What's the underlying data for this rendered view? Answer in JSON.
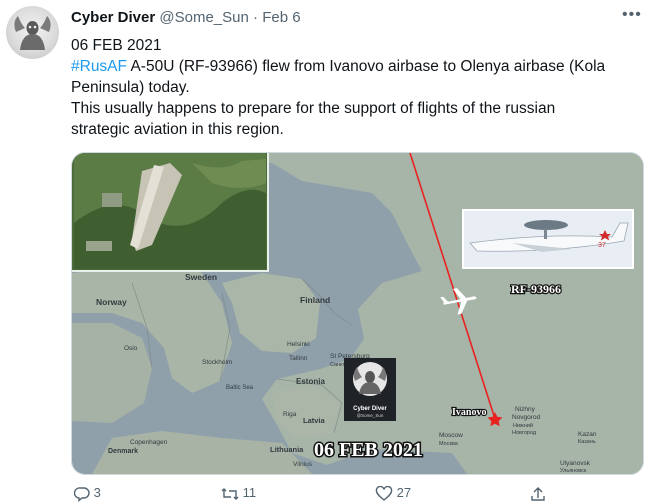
{
  "tweet": {
    "author_name": "Cyber Diver",
    "handle": "@Some_Sun",
    "separator": "·",
    "date": "Feb 6",
    "more_label": "•••",
    "date_line": "06 FEB 2021",
    "hashtag": "#RusAF",
    "line1_rest": " A-50U (RF-93966) flew from Ivanovo airbase to Olenya airbase (Kola",
    "line2": "Peninsula) today.",
    "line3": "This usually happens to prepare for the support of flights of the russian",
    "line4": "strategic aviation in this region."
  },
  "media": {
    "map_labels": {
      "sweden": "Sweden",
      "norway": "Norway",
      "finland": "Finland",
      "oslo": "Oslo",
      "stockholm": "Stockholm",
      "helsinki": "Helsinki",
      "tallinn": "Tallinn",
      "st_petersburg": "St Petersburg",
      "st_petersburg_ru": "Санкт-Петербург",
      "estonia": "Estonia",
      "baltic_sea": "Baltic Sea",
      "riga": "Riga",
      "latvia": "Latvia",
      "copenhagen": "Copenhagen",
      "denmark": "Denmark",
      "lithuania": "Lithuania",
      "vilnius": "Vilnius",
      "moscow": "Moscow",
      "moscow_ru": "Москва",
      "nizhny": "Nizhny",
      "novgorod": "Novgorod",
      "nizhny_ru": "Нижний",
      "novgorod_ru": "Новгород",
      "kazan": "Kazan",
      "kazan_ru": "Казань",
      "ulyanovsk": "Ulyanovsk",
      "ulyanovsk_ru": "Ульяновск"
    },
    "ivanovo_label": "Ivanovo",
    "aircraft_reg": "RF-93966",
    "date_banner": "06 FEB 2021",
    "watermark_name": "Cyber Diver",
    "watermark_handle": "@Some_Sun",
    "route_color": "#e8231f"
  },
  "actions": {
    "replies": "3",
    "retweets": "11",
    "likes": "27"
  }
}
